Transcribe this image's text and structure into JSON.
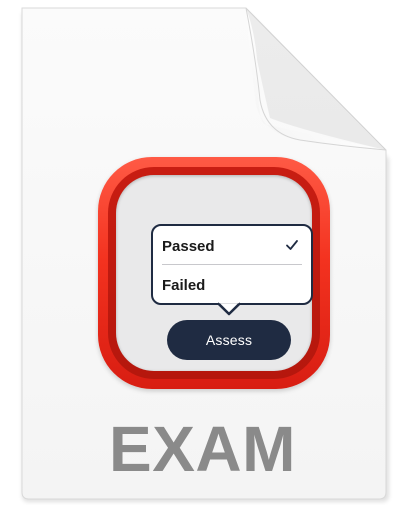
{
  "document": {
    "file_type_label": "EXAM"
  },
  "app_icon": {
    "icon": "exam-assessment-icon",
    "colors": {
      "frame": "#f3321f",
      "plate": "#e9e9ea",
      "navy": "#1f2b42"
    },
    "popover": {
      "options": [
        {
          "label": "Passed",
          "selected": true
        },
        {
          "label": "Failed",
          "selected": false
        }
      ],
      "selected_icon": "checkmark-icon"
    },
    "button": {
      "label": "Assess"
    }
  }
}
